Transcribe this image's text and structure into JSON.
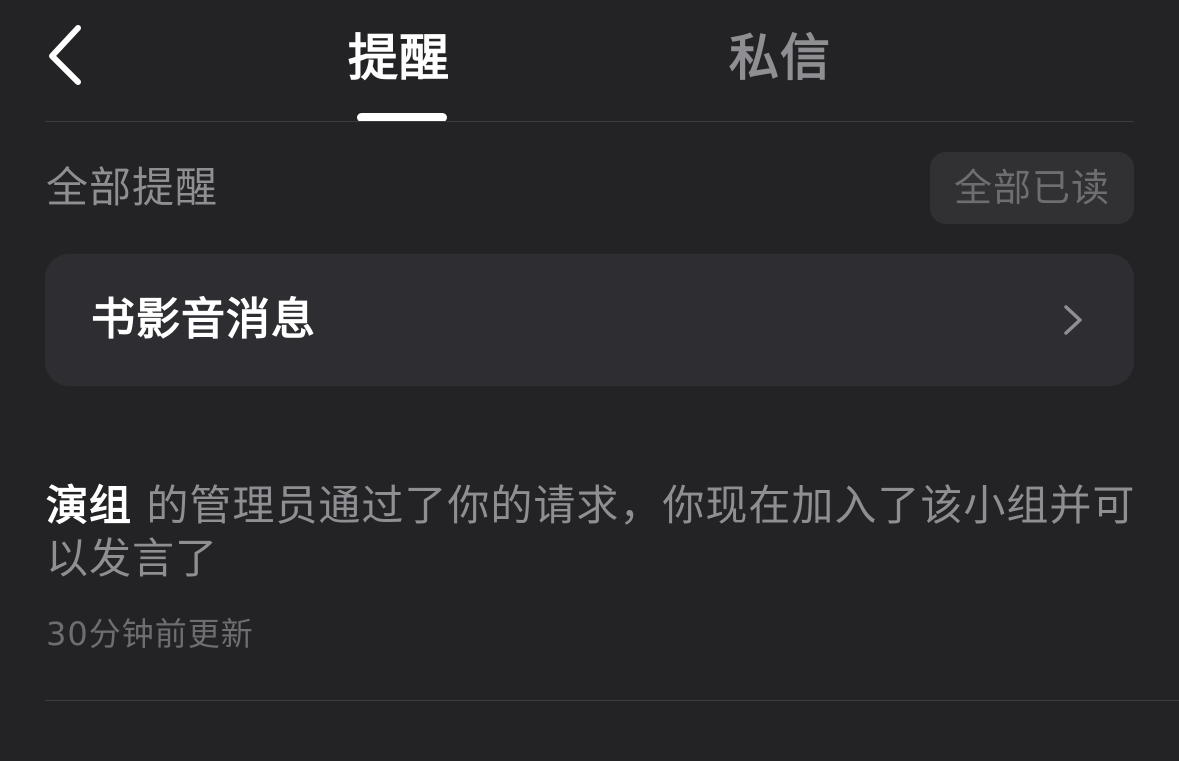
{
  "header": {
    "back_icon": "chevron-left-icon",
    "tabs": [
      {
        "label": "提醒",
        "active": true
      },
      {
        "label": "私信",
        "active": false
      }
    ]
  },
  "section": {
    "title": "全部提醒",
    "mark_all_read_label": "全部已读"
  },
  "media_card": {
    "label": "书影音消息",
    "icon": "chevron-right-icon"
  },
  "notification": {
    "group_name": "演组",
    "message": " 的管理员通过了你的请求，你现在加入了该小组并可以发言了",
    "time": "30分钟前更新"
  },
  "colors": {
    "background": "#232325",
    "card": "#2e2d32",
    "primary_text": "#ffffff",
    "secondary_text": "#8e8e93",
    "muted_text": "#6d6d72"
  }
}
